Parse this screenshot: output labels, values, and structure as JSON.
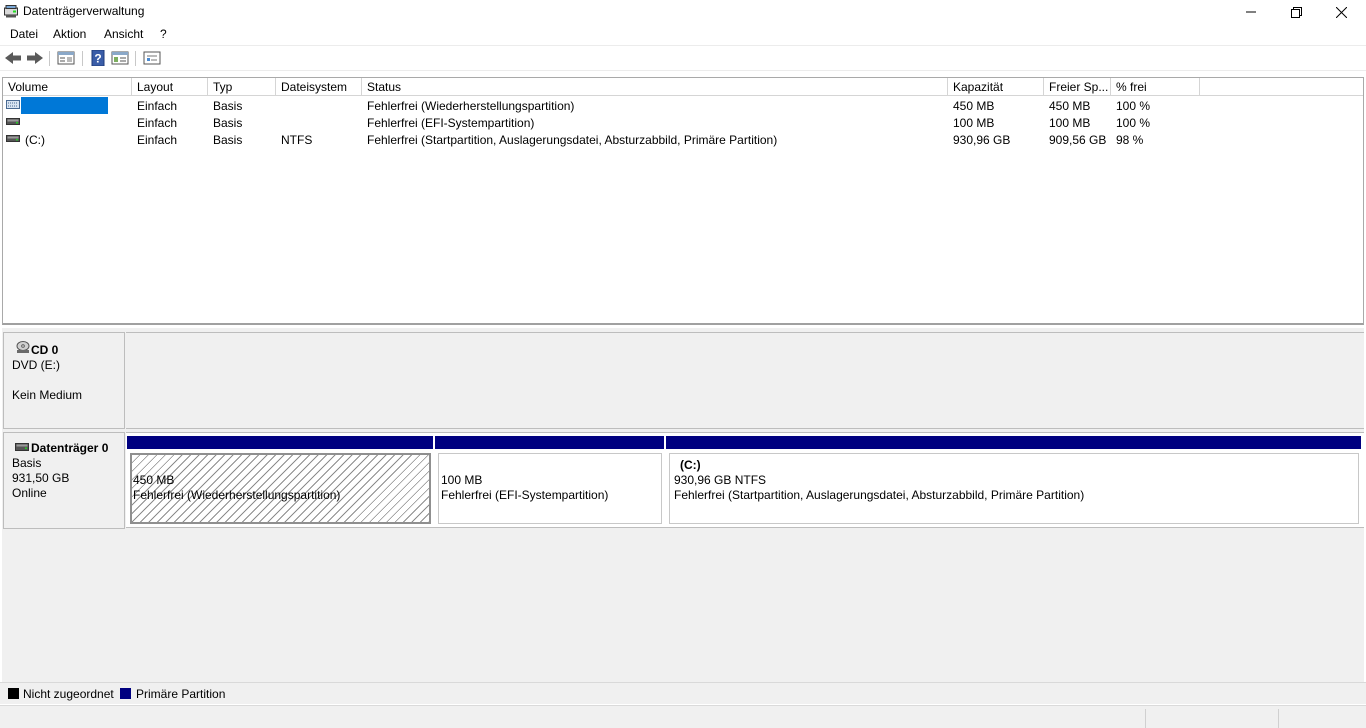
{
  "window": {
    "title": "Datenträgerverwaltung",
    "icon": "disk-management-icon"
  },
  "menu": [
    "Datei",
    "Aktion",
    "Ansicht",
    "?"
  ],
  "toolbar": {
    "icons": [
      "back-arrow-icon",
      "forward-arrow-icon",
      "properties-list-icon",
      "help-icon",
      "console-tree-icon",
      "properties-icon"
    ]
  },
  "volume_table": {
    "columns": [
      "Volume",
      "Layout",
      "Typ",
      "Dateisystem",
      "Status",
      "Kapazität",
      "Freier Sp...",
      "% frei"
    ],
    "rows": [
      {
        "volume": "",
        "layout": "Einfach",
        "typ": "Basis",
        "dateisystem": "",
        "status": "Fehlerfrei (Wiederherstellungspartition)",
        "kapazitaet": "450 MB",
        "frei": "450 MB",
        "prozent": "100 %",
        "selected": true
      },
      {
        "volume": "",
        "layout": "Einfach",
        "typ": "Basis",
        "dateisystem": "",
        "status": "Fehlerfrei (EFI-Systempartition)",
        "kapazitaet": "100 MB",
        "frei": "100 MB",
        "prozent": "100 %",
        "selected": false
      },
      {
        "volume": "(C:)",
        "layout": "Einfach",
        "typ": "Basis",
        "dateisystem": "NTFS",
        "status": "Fehlerfrei (Startpartition, Auslagerungsdatei, Absturzabbild, Primäre Partition)",
        "kapazitaet": "930,96 GB",
        "frei": "909,56 GB",
        "prozent": "98 %",
        "selected": false
      }
    ]
  },
  "disks": {
    "cd": {
      "name": "CD 0",
      "type": "DVD (E:)",
      "state": "Kein Medium"
    },
    "disk0": {
      "name": "Datenträger 0",
      "type": "Basis",
      "size": "931,50 GB",
      "state": "Online",
      "partitions": [
        {
          "label": "",
          "size": "450 MB",
          "status": "Fehlerfrei (Wiederherstellungspartition)"
        },
        {
          "label": "",
          "size": "100 MB",
          "status": "Fehlerfrei (EFI-Systempartition)"
        },
        {
          "label": "(C:)",
          "size": "930,96 GB NTFS",
          "status": "Fehlerfrei (Startpartition, Auslagerungsdatei, Absturzabbild, Primäre Partition)"
        }
      ]
    }
  },
  "legend": [
    {
      "label": "Nicht zugeordnet",
      "color": "#000000"
    },
    {
      "label": "Primäre Partition",
      "color": "#000080"
    }
  ]
}
